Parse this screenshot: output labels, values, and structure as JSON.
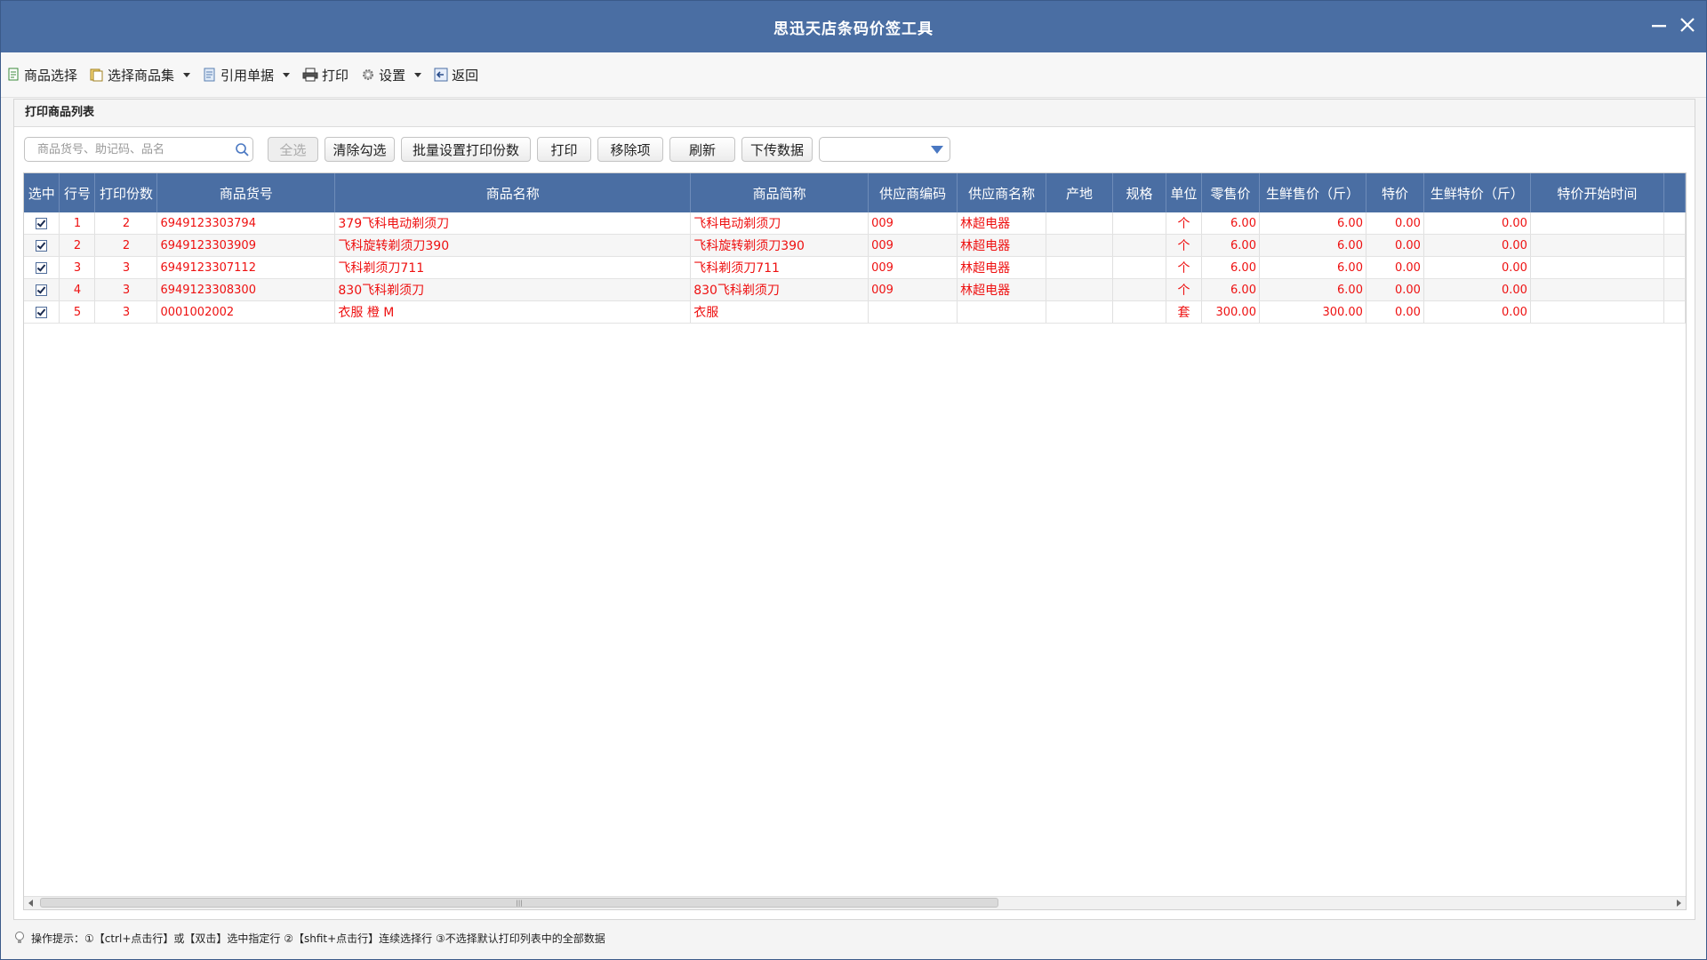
{
  "window": {
    "title": "思迅天店条码价签工具"
  },
  "toolbar": {
    "items": [
      {
        "label": "商品选择",
        "icon": "product-select-icon",
        "dropdown": false
      },
      {
        "label": "选择商品集",
        "icon": "product-set-icon",
        "dropdown": true
      },
      {
        "label": "引用单据",
        "icon": "document-icon",
        "dropdown": true
      },
      {
        "label": "打印",
        "icon": "printer-icon",
        "dropdown": false
      },
      {
        "label": "设置",
        "icon": "gear-icon",
        "dropdown": true
      },
      {
        "label": "返回",
        "icon": "return-icon",
        "dropdown": false
      }
    ]
  },
  "panel": {
    "title": "打印商品列表"
  },
  "filter": {
    "search_placeholder": "商品货号、助记码、品名",
    "buttons": {
      "select_all": "全选",
      "clear_selection": "清除勾选",
      "batch_copies": "批量设置打印份数",
      "print": "打印",
      "remove": "移除项",
      "refresh": "刷新",
      "upload": "下传数据"
    },
    "select_value": ""
  },
  "table": {
    "columns": [
      "选中",
      "行号",
      "打印份数",
      "商品货号",
      "商品名称",
      "商品简称",
      "供应商编码",
      "供应商名称",
      "产地",
      "规格",
      "单位",
      "零售价",
      "生鲜售价（斤）",
      "特价",
      "生鲜特价（斤）",
      "特价开始时间",
      ""
    ],
    "rows": [
      {
        "checked": true,
        "line": "1",
        "copies": "2",
        "code": "6949123303794",
        "name": "379飞科电动剃须刀",
        "short": "飞科电动剃须刀",
        "supplier_code": "009",
        "supplier_name": "林超电器",
        "origin": "",
        "spec": "",
        "unit": "个",
        "retail": "6.00",
        "fresh_price": "6.00",
        "special": "0.00",
        "fresh_special": "0.00",
        "special_start": ""
      },
      {
        "checked": true,
        "line": "2",
        "copies": "2",
        "code": "6949123303909",
        "name": "飞科旋转剃须刀390",
        "short": "飞科旋转剃须刀390",
        "supplier_code": "009",
        "supplier_name": "林超电器",
        "origin": "",
        "spec": "",
        "unit": "个",
        "retail": "6.00",
        "fresh_price": "6.00",
        "special": "0.00",
        "fresh_special": "0.00",
        "special_start": ""
      },
      {
        "checked": true,
        "line": "3",
        "copies": "3",
        "code": "6949123307112",
        "name": "飞科剃须刀711",
        "short": "飞科剃须刀711",
        "supplier_code": "009",
        "supplier_name": "林超电器",
        "origin": "",
        "spec": "",
        "unit": "个",
        "retail": "6.00",
        "fresh_price": "6.00",
        "special": "0.00",
        "fresh_special": "0.00",
        "special_start": ""
      },
      {
        "checked": true,
        "line": "4",
        "copies": "3",
        "code": "6949123308300",
        "name": "830飞科剃须刀",
        "short": "830飞科剃须刀",
        "supplier_code": "009",
        "supplier_name": "林超电器",
        "origin": "",
        "spec": "",
        "unit": "个",
        "retail": "6.00",
        "fresh_price": "6.00",
        "special": "0.00",
        "fresh_special": "0.00",
        "special_start": ""
      },
      {
        "checked": true,
        "line": "5",
        "copies": "3",
        "code": "0001002002",
        "name": "衣服 橙 M",
        "short": "衣服",
        "supplier_code": "",
        "supplier_name": "",
        "origin": "",
        "spec": "",
        "unit": "套",
        "retail": "300.00",
        "fresh_price": "300.00",
        "special": "0.00",
        "fresh_special": "0.00",
        "special_start": ""
      }
    ]
  },
  "statusbar": {
    "hint": "操作提示：①【ctrl+点击行】或【双击】选中指定行 ②【shfit+点击行】连续选择行 ③不选择默认打印列表中的全部数据",
    "icon": "lightbulb-icon"
  },
  "colors": {
    "title_bar": "#4a6ea3",
    "header": "#4a6ea3",
    "row_text": "#ee1111"
  }
}
